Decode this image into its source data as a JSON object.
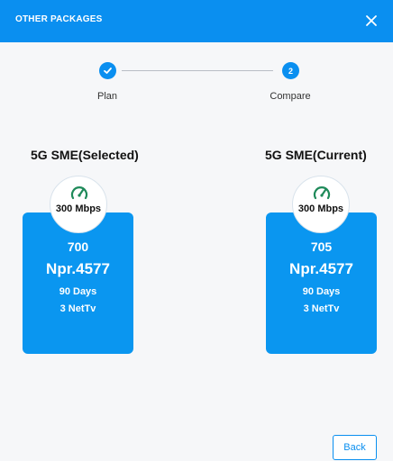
{
  "header": {
    "title": "OTHER PACKAGES",
    "close_icon": "close-icon"
  },
  "stepper": {
    "steps": [
      {
        "label": "Plan",
        "state": "done",
        "icon": "check-icon"
      },
      {
        "label": "Compare",
        "number": "2",
        "state": "active"
      }
    ]
  },
  "packages": [
    {
      "title": "5G SME(Selected)",
      "speed": "300 Mbps",
      "code": "700",
      "price": "Npr.4577",
      "days": "90 Days",
      "tv": "3 NetTv"
    },
    {
      "title": "5G SME(Current)",
      "speed": "300 Mbps",
      "code": "705",
      "price": "Npr.4577",
      "days": "90 Days",
      "tv": "3 NetTv"
    }
  ],
  "footer": {
    "back_label": "Back"
  },
  "colors": {
    "primary": "#0a8ff0",
    "card": "#0a96f0",
    "speed_icon": "#1f8a5a"
  }
}
